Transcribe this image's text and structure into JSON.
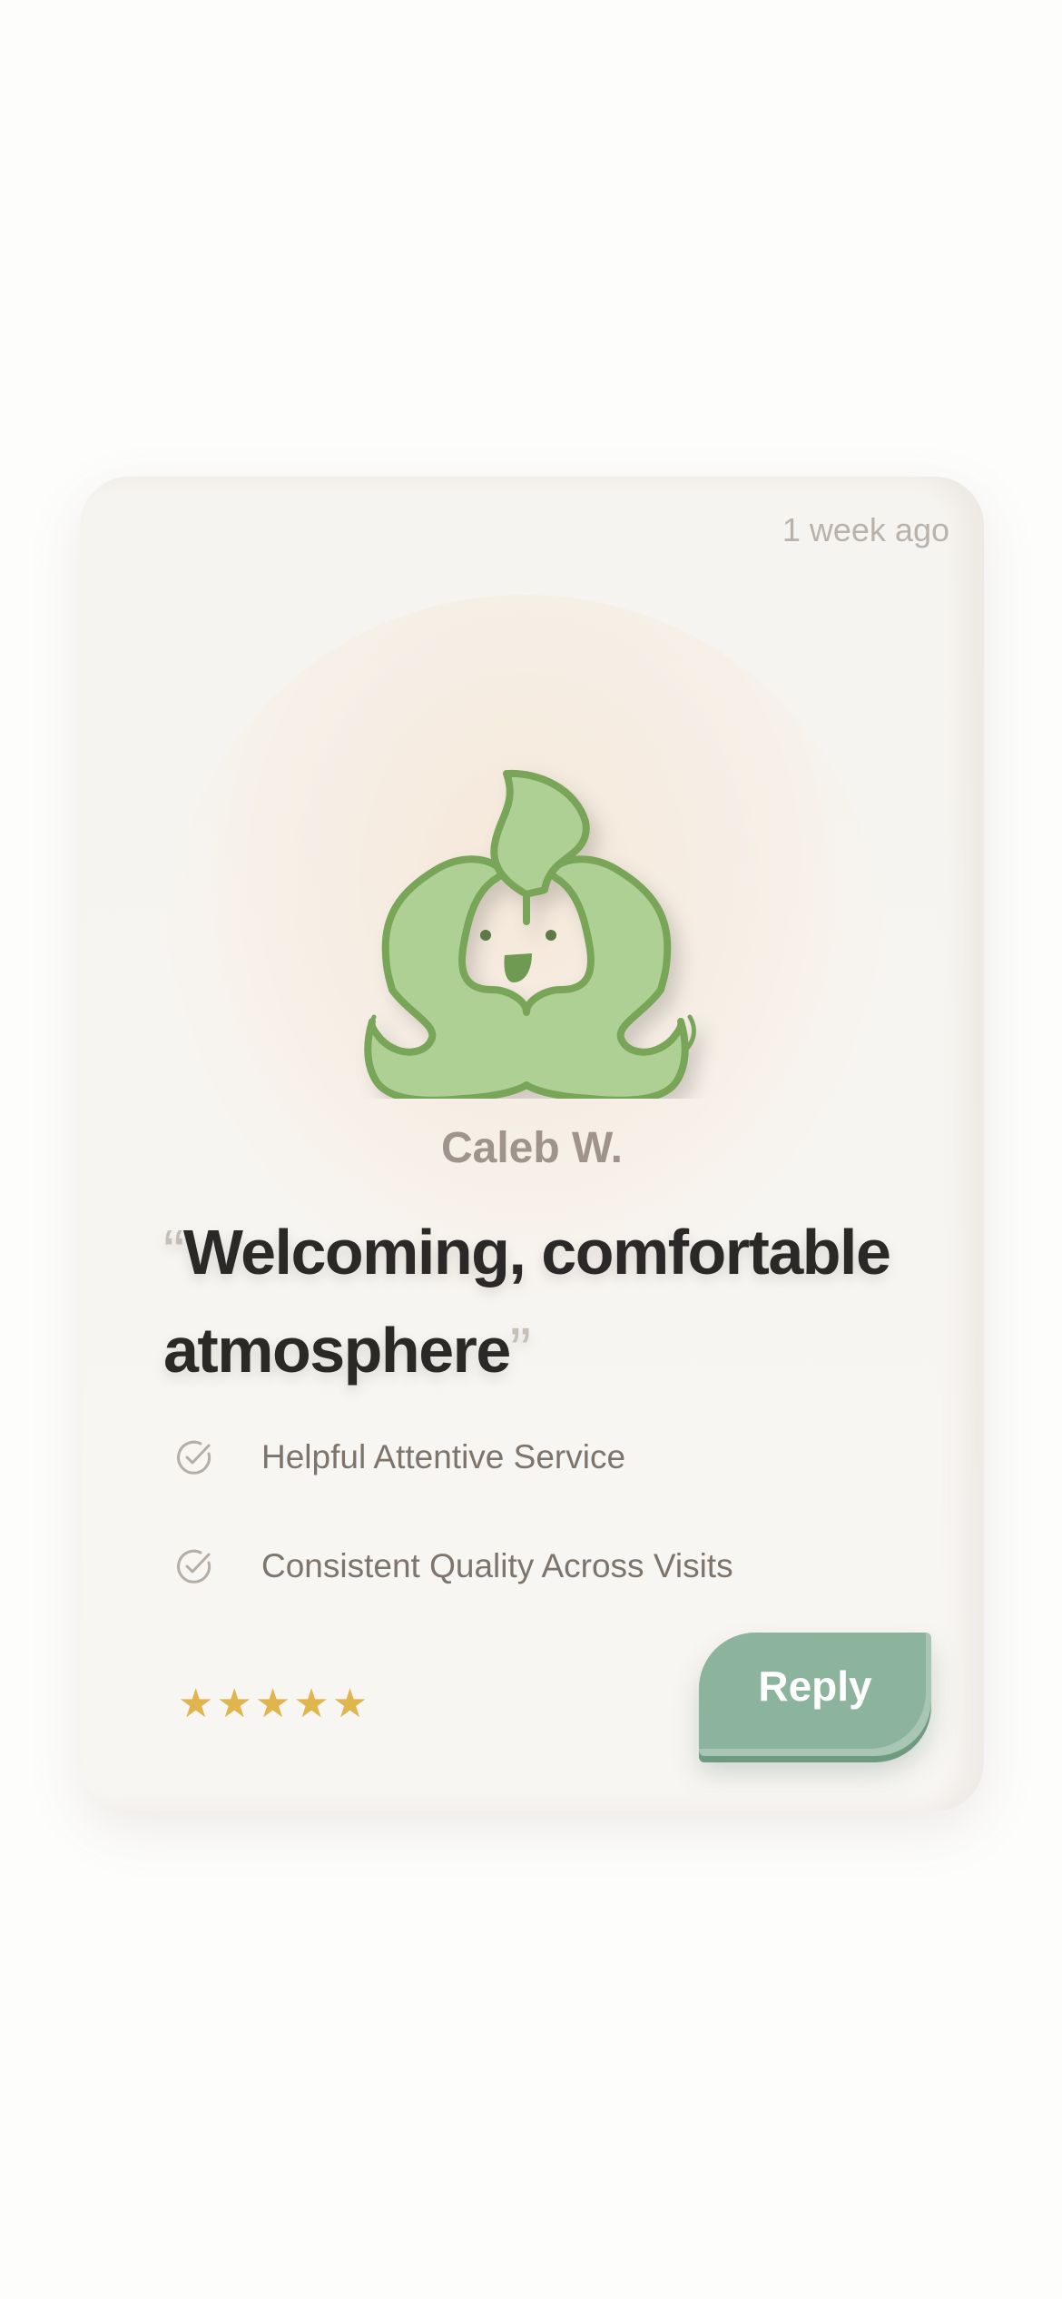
{
  "review": {
    "timestamp": "1 week ago",
    "reviewer_name": "Caleb W.",
    "quote_open": "“",
    "quote_text": "Welcoming, comfortable atmosphere",
    "quote_close": "”",
    "features": [
      {
        "label": "Helpful Attentive Service",
        "icon": "check-circle-icon"
      },
      {
        "label": "Consistent Quality Across Visits",
        "icon": "check-circle-icon"
      }
    ],
    "rating": 5,
    "rating_max": 5,
    "reply_label": "Reply",
    "avatar": "leaf-mascot"
  },
  "colors": {
    "accent": "#8cb39b",
    "star": "#e0b54e",
    "leaf_fill": "#aed095",
    "leaf_stroke": "#78a558"
  }
}
